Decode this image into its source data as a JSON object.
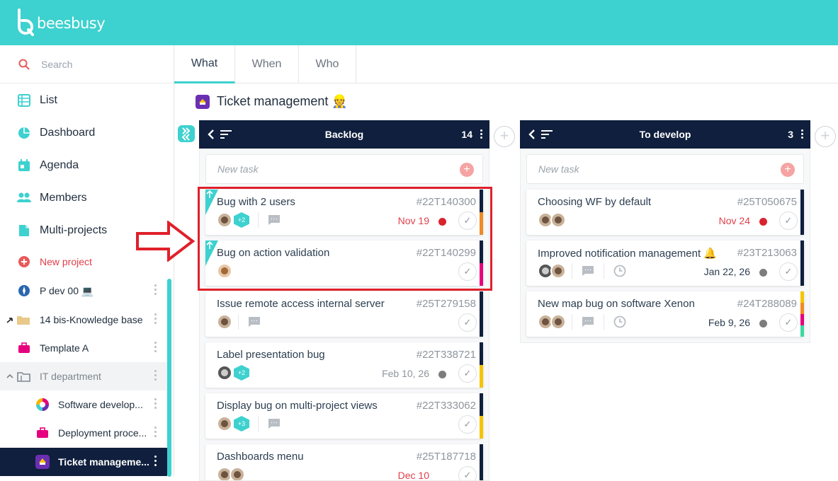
{
  "app": {
    "logo_text": "beesbusy",
    "brand_color": "#3dd1cf",
    "nav_dark": "#0f1f3d"
  },
  "sidebar": {
    "search_placeholder": "Search",
    "nav": [
      {
        "label": "List",
        "icon": "list-icon"
      },
      {
        "label": "Dashboard",
        "icon": "pie-chart-icon"
      },
      {
        "label": "Agenda",
        "icon": "calendar-icon"
      },
      {
        "label": "Members",
        "icon": "users-icon"
      },
      {
        "label": "Multi-projects",
        "icon": "document-icon"
      }
    ],
    "new_project": "New project",
    "projects": [
      {
        "label": "P dev 00 💻",
        "icon": "rebel-icon"
      },
      {
        "label": "14 bis-Knowledge base",
        "icon": "folder-icon"
      },
      {
        "label": "Template A",
        "icon": "briefcase-icon"
      },
      {
        "label": "IT department",
        "icon": "folder-group-icon"
      },
      {
        "label": "Software develop...",
        "icon": "color-wheel-icon"
      },
      {
        "label": "Deployment proce...",
        "icon": "briefcase-icon"
      },
      {
        "label": "Ticket manageme...",
        "icon": "ticket-icon"
      }
    ]
  },
  "tabs": [
    "What",
    "When",
    "Who"
  ],
  "project_title": "Ticket management 👷",
  "columns": [
    {
      "title": "Backlog",
      "count": "14",
      "new_task": "New task",
      "cards": [
        {
          "title": "Bug with 2 users",
          "id": "#22T140300",
          "extra": "+2",
          "date": "Nov 19",
          "date_color": "#e0404a",
          "dot": "#d9232d"
        },
        {
          "title": "Bug on action validation",
          "id": "#22T140299",
          "extra": "",
          "date": "",
          "date_color": "",
          "dot": ""
        },
        {
          "title": "Issue remote access internal server",
          "id": "#25T279158",
          "extra": "",
          "date": "",
          "date_color": "",
          "dot": ""
        },
        {
          "title": "Label presentation bug",
          "id": "#22T338721",
          "extra": "+2",
          "date": "Feb 10, 26",
          "date_color": "#8e969e",
          "dot": "#7d7d7d"
        },
        {
          "title": "Display bug on multi-project views",
          "id": "#22T333062",
          "extra": "+3",
          "date": "",
          "date_color": "",
          "dot": ""
        },
        {
          "title": "Dashboards menu",
          "id": "#25T187718",
          "extra": "",
          "date": "Dec 10",
          "date_color": "#e0404a",
          "dot": ""
        }
      ]
    },
    {
      "title": "To develop",
      "count": "3",
      "new_task": "New task",
      "cards": [
        {
          "title": "Choosing WF by default",
          "id": "#25T050675",
          "date": "Nov 24",
          "date_color": "#e0404a",
          "dot": "#d9232d"
        },
        {
          "title": "Improved notification management 🔔",
          "id": "#23T213063",
          "date": "Jan 22, 26",
          "date_color": "#2c3e50",
          "dot": "#7d7d7d"
        },
        {
          "title": "New map bug on software Xenon",
          "id": "#24T288089",
          "date": "Feb 9, 26",
          "date_color": "#2c3e50",
          "dot": "#7d7d7d"
        }
      ]
    }
  ]
}
